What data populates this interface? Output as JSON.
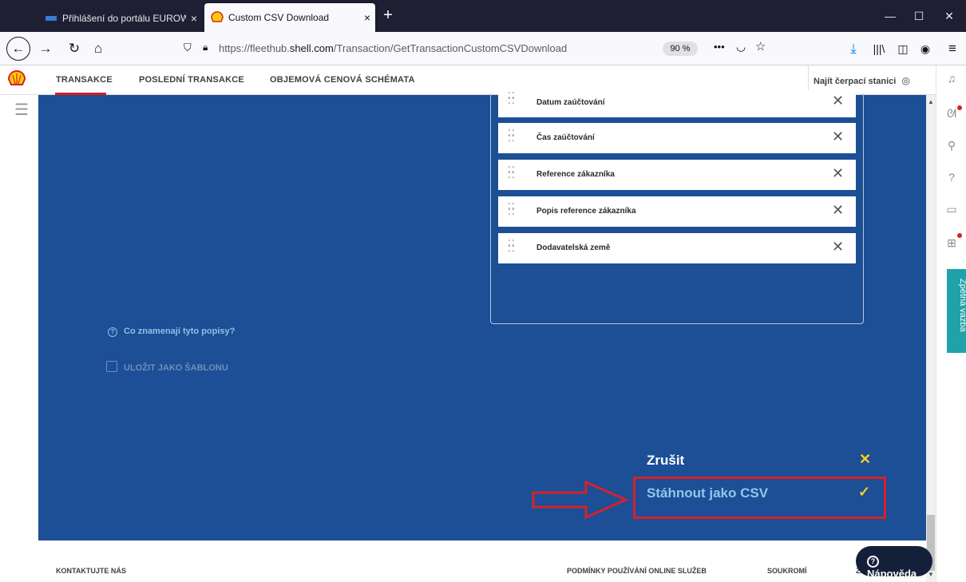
{
  "browser": {
    "tabs": [
      {
        "title": "Přihlášení do portálu EUROWAG",
        "close": "×"
      },
      {
        "title": "Custom CSV Download",
        "close": "×"
      }
    ],
    "new_tab": "+",
    "window_controls": {
      "minimize": "—",
      "maximize": "☐",
      "close": "✕"
    },
    "url_prefix": "https://fleethub.",
    "url_domain": "shell.com",
    "url_path": "/Transaction/GetTransactionCustomCSVDownload",
    "zoom": "90 %"
  },
  "header": {
    "nav": [
      "TRANSAKCE",
      "POSLEDNÍ TRANSAKCE",
      "OBJEMOVÁ CENOVÁ SCHÉMATA"
    ],
    "find_station": "Najít čerpací stanici"
  },
  "fields": [
    "Datum zaúčtování",
    "Čas zaúčtování",
    "Reference zákazníka",
    "Popis reference zákazníka",
    "Dodavatelská země"
  ],
  "help_link": "Co znamenají tyto popisy?",
  "save_template": "ULOŽIT JAKO ŠABLONU",
  "actions": {
    "cancel": "Zrušit",
    "download": "Stáhnout jako CSV"
  },
  "footer": {
    "contact": "KONTAKTUJTE NÁS",
    "terms": "PODMÍNKY POUŽÍVÁNÍ ONLINE SLUŽEB",
    "privacy": "SOUKROMÍ",
    "cut": "ZÁ"
  },
  "help_button": "Nápověda",
  "feedback_tab": "Zpětná vazba",
  "colors": {
    "panel": "#1c4f96",
    "highlight": "#d8202a",
    "accent_yellow": "#f7d117",
    "shell_red": "#dd1d21"
  }
}
